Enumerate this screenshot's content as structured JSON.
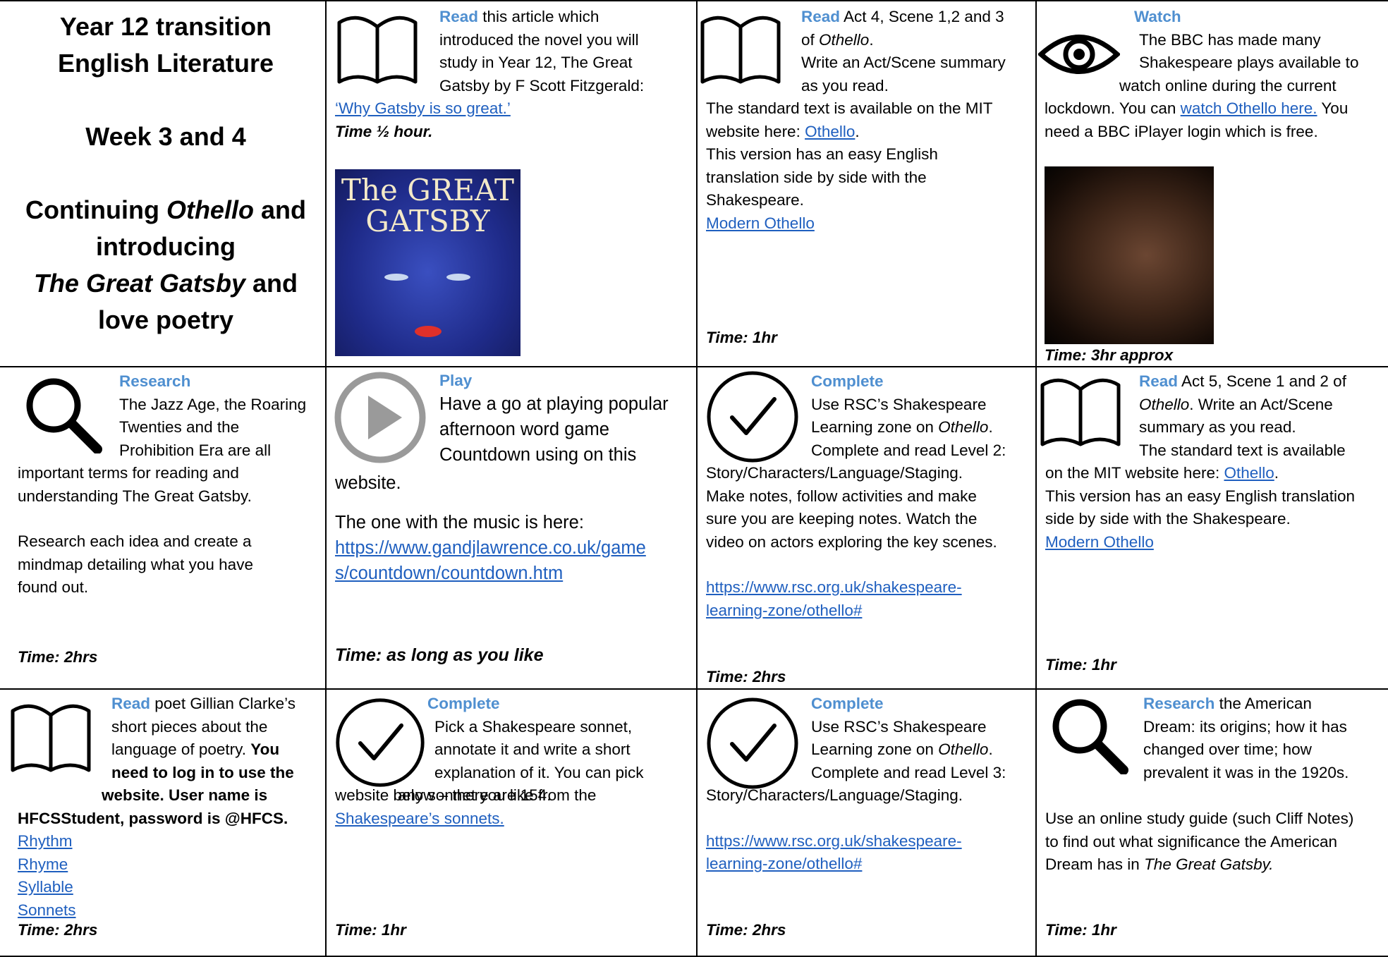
{
  "title": {
    "line1": "Year 12 transition",
    "line2": "English Literature",
    "week": "Week 3 and 4",
    "sub1a": "Continuing ",
    "sub1b": "Othello",
    "sub1c": " and",
    "sub2": "introducing",
    "sub3a": "The Great Gatsby",
    "sub3b": " and",
    "sub4": "love poetry"
  },
  "r1c2": {
    "head": "Read",
    "l1": " this article which",
    "l2": "introduced the novel you will",
    "l3": "study in Year 12, The Great",
    "l4": "Gatsby by F Scott Fitzgerald:",
    "link": "‘Why Gatsby is so great.’",
    "time": "Time ½ hour.",
    "cover_title1": "The GREAT",
    "cover_title2": "GATSBY"
  },
  "r1c3": {
    "head": "Read",
    "l1": " Act 4, Scene 1,2 and 3",
    "l2a": "of ",
    "l2b": "Othello",
    "l2c": ".",
    "l3": "Write an Act/Scene summary",
    "l4": "as you read.",
    "l5": "The standard text is available on the MIT",
    "l6a": "website here: ",
    "l6link": "Othello",
    "l6b": ".",
    "l7": "This version has an easy English",
    "l8": "translation side by side with the",
    "l9": "Shakespeare.",
    "link2": "Modern Othello",
    "time": "Time: 1hr"
  },
  "r1c4": {
    "head": "Watch",
    "l1": "The BBC has made many",
    "l2": "Shakespeare plays available to",
    "l3": "watch online during the current",
    "l4a": "lockdown. You can ",
    "l4link": "watch Othello here.",
    "l4b": " You",
    "l5": "need a BBC iPlayer login which is free.",
    "time": "Time: 3hr approx"
  },
  "r2c1": {
    "head": "Research",
    "l1": "The Jazz Age, the Roaring",
    "l2": "Twenties and the",
    "l3": "Prohibition Era are all",
    "l4": "important terms for reading and",
    "l5": "understanding The Great Gatsby.",
    "l6": "Research each idea and create a",
    "l7": "mindmap detailing what you have",
    "l8": "found out.",
    "time": "Time: 2hrs"
  },
  "r2c2": {
    "head": "Play",
    "l1": "Have a go at playing popular",
    "l2": "afternoon word game",
    "l3": "Countdown using on this",
    "l4": "website.",
    "l5": "The one with the music is here:",
    "link1": "https://www.gandjlawrence.co.uk/game",
    "link2": "s/countdown/countdown.htm",
    "time": "Time: as long as you like"
  },
  "r2c3": {
    "head": "Complete",
    "l1": "Use RSC’s Shakespeare",
    "l2a": "Learning zone on ",
    "l2b": "Othello",
    "l2c": ".",
    "l3": "Complete and read  Level 2:",
    "l4": "Story/Characters/Language/Staging.",
    "l5": "Make notes, follow activities and make",
    "l6": "sure you are keeping notes.  Watch the",
    "l7": "video on actors exploring the key scenes.",
    "link1": "https://www.rsc.org.uk/shakespeare-",
    "link2": "learning-zone/othello#",
    "time": "Time: 2hrs"
  },
  "r2c4": {
    "head": "Read",
    "l1": " Act 5, Scene 1 and 2 of",
    "l2a": "Othello",
    "l2b": ".  Write an Act/Scene",
    "l3": "summary as you read.",
    "l4": "The standard text is available",
    "l5a": "on the MIT website here: ",
    "l5link": "Othello",
    "l5b": ".",
    "l6": "This version has an easy English translation",
    "l7": "side by side with the Shakespeare.",
    "link2": "Modern Othello",
    "time": "Time: 1hr"
  },
  "r3c1": {
    "head": "Read",
    "l1": " poet Gillian Clarke’s",
    "l2": "short pieces about the",
    "l3a": "language of poetry. ",
    "l3b": "You",
    "l4": "need to log in to use the",
    "l5": "website. User name is",
    "l6": "HFCSStudent, password is @HFCS.",
    "links": [
      "Rhythm",
      "Rhyme",
      "Syllable",
      "Sonnets"
    ],
    "time": "Time: 2hrs"
  },
  "r3c2": {
    "head": "Complete",
    "l1": "Pick a Shakespeare sonnet,",
    "l2": "annotate it and write a short",
    "l3": "explanation of it. You can pick",
    "l4": "any sonnet you like from the",
    "l5": "website below – there are 154.",
    "link": "Shakespeare’s sonnets.",
    "time": "Time: 1hr"
  },
  "r3c3": {
    "head": "Complete",
    "l1": "Use RSC’s Shakespeare",
    "l2a": "Learning zone on ",
    "l2b": "Othello",
    "l2c": ".",
    "l3": "Complete and read Level 3:",
    "l4": "Story/Characters/Language/Staging.",
    "link1": "https://www.rsc.org.uk/shakespeare-",
    "link2": "learning-zone/othello#",
    "time": "Time: 2hrs"
  },
  "r3c4": {
    "head": "Research",
    "l1": " the American",
    "l2": "Dream: its origins; how it has",
    "l3": "changed over time; how",
    "l4": "prevalent it was in the 1920s.",
    "l5": "Use an online study guide (such Cliff Notes)",
    "l6": "to find out what significance the American",
    "l7a": "Dream has in ",
    "l7b": "The Great Gatsby.",
    "time": "Time: 1hr"
  },
  "icons": [
    "book-icon",
    "eye-icon",
    "magnifier-icon",
    "play-icon",
    "checkmark-icon"
  ],
  "colors": {
    "heading": "#4f8fd0",
    "link": "#1f5fbf",
    "grid": "#000000"
  }
}
